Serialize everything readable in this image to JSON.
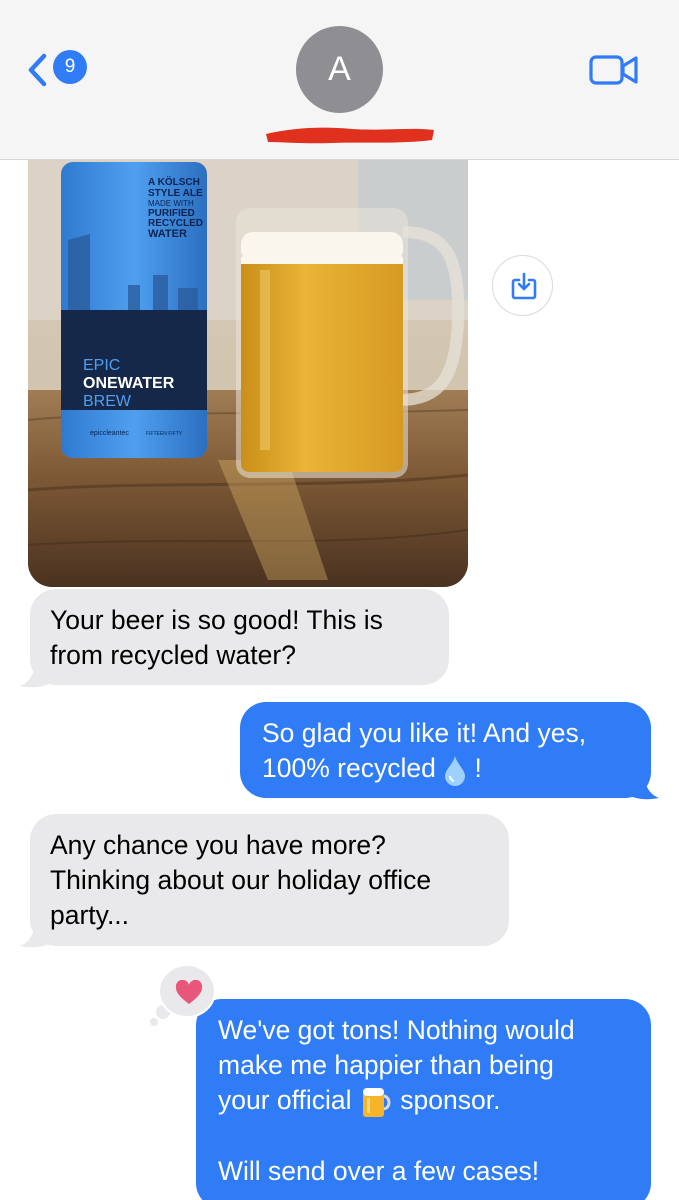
{
  "header": {
    "back_badge_count": "9",
    "contact_initial": "A"
  },
  "thread": {
    "photo": {
      "can_label": {
        "style_line1": "A KÖLSCH",
        "style_line2": "STYLE ALE",
        "made_with": "MADE WITH",
        "purified": "PURIFIED",
        "recycled": "RECYCLED",
        "water": "WATER",
        "brand1": "EPIC",
        "brand2": "ONEWATER",
        "brand3": "BREW",
        "maker": "epiccleantec",
        "footer": "FIFTEEN FIFTY"
      }
    },
    "messages": [
      {
        "direction": "incoming",
        "text": "Your beer is so good! This is\nfrom recycled water?"
      },
      {
        "direction": "outgoing",
        "text_before_emoji": "So glad you like it! And yes,\n100% recycled ",
        "emoji": "droplet",
        "text_after_emoji": " !"
      },
      {
        "direction": "incoming",
        "text": "Any chance you have more?\nThinking about our holiday office\nparty..."
      },
      {
        "direction": "outgoing",
        "text_before_emoji": "We've got tons! Nothing would\nmake me happier than being\nyour official ",
        "emoji": "beer-mug",
        "text_after_emoji": " sponsor.\n\nWill send over a few cases!",
        "tapback": "heart"
      }
    ]
  },
  "colors": {
    "outgoing_bubble": "#2f7cf6",
    "incoming_bubble": "#e9e9eb",
    "accent": "#2f7cf6",
    "tapback_heart": "#e8567c"
  }
}
